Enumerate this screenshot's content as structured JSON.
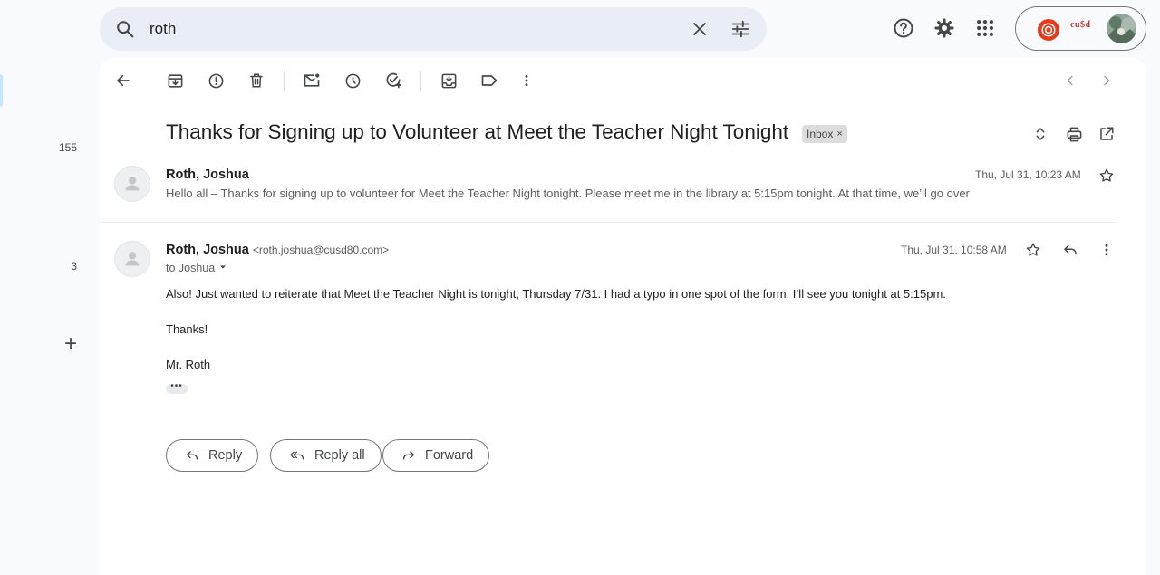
{
  "search": {
    "query": "roth"
  },
  "rail": {
    "counts": [
      "155",
      "3"
    ]
  },
  "thread": {
    "subject": "Thanks for Signing up to Volunteer at Meet the Teacher Night Tonight",
    "label": "Inbox",
    "label_remove": "×"
  },
  "messages": [
    {
      "sender": "Roth, Joshua",
      "date": "Thu, Jul 31, 10:23 AM",
      "snippet": "Hello all – Thanks for signing up to volunteer for Meet the Teacher Night tonight. Please meet me in the library at 5:15pm tonight. At that time, we’ll go over"
    },
    {
      "sender": "Roth, Joshua",
      "email": "<roth.joshua@cusd80.com>",
      "date": "Thu, Jul 31, 10:58 AM",
      "to": "to Joshua",
      "body": [
        "Also! Just wanted to reiterate that Meet the Teacher Night is tonight, Thursday 7/31. I had a typo in one spot of the form. I’ll see you tonight at 5:15pm.",
        "Thanks!",
        "Mr. Roth"
      ],
      "trimmed": "•••"
    }
  ],
  "actions": {
    "reply": "Reply",
    "reply_all": "Reply all",
    "forward": "Forward"
  },
  "account": {
    "logo_text": "cu$d"
  }
}
